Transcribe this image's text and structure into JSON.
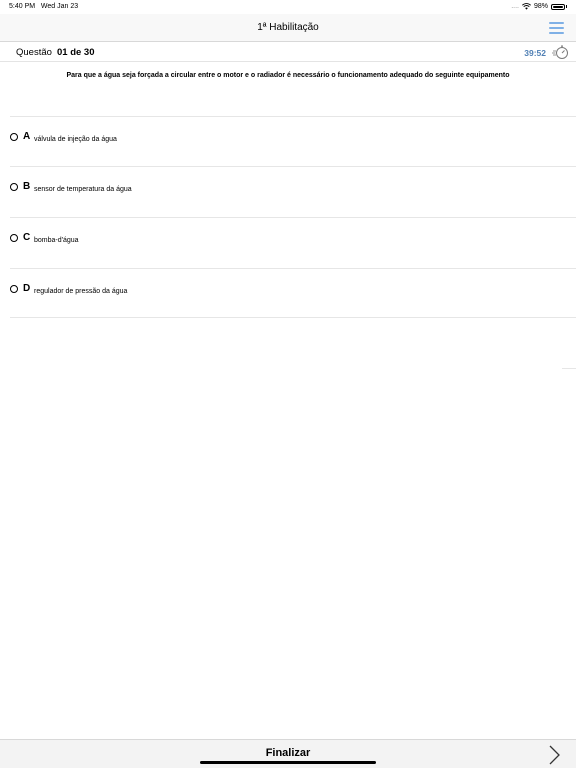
{
  "status_bar": {
    "time": "5:40 PM",
    "date": "Wed Jan 23",
    "signal": "....",
    "battery_percent": "98%",
    "battery_level": 0.98
  },
  "nav": {
    "title": "1ª Habilitação",
    "menu_icon": "hamburger-menu-icon",
    "accent_color": "#7fb0e6"
  },
  "question": {
    "label": "Questão",
    "number": "01 de 30",
    "timer": "39:52",
    "timer_color": "#4f7fb4",
    "text": "Para que a água seja forçada a circular entre o motor e o radiador é necessário o funcionamento adequado do seguinte equipamento"
  },
  "options": [
    {
      "letter": "A",
      "text": "válvula de injeção da água"
    },
    {
      "letter": "B",
      "text": "sensor de temperatura da água"
    },
    {
      "letter": "C",
      "text": "bomba-d'água"
    },
    {
      "letter": "D",
      "text": "regulador de pressão da água"
    }
  ],
  "footer": {
    "finalize_label": "Finalizar",
    "next_icon": "chevron-right-icon"
  }
}
